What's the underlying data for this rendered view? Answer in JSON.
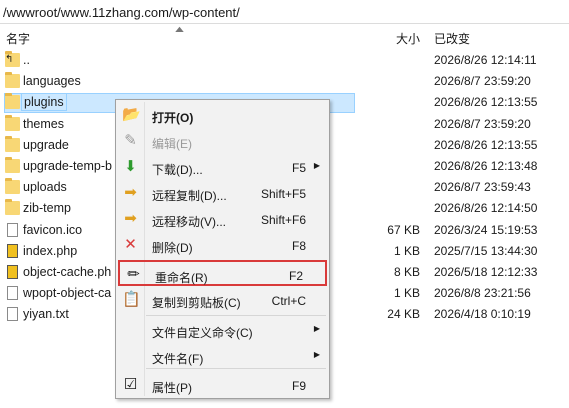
{
  "path": "/wwwroot/www.11zhang.com/wp-content/",
  "columns": {
    "name": "名字",
    "size": "大小",
    "modified": "已改变"
  },
  "files": [
    {
      "name": "..",
      "size": "",
      "modified": "2026/8/26 12:14:11",
      "type": "up-folder"
    },
    {
      "name": "languages",
      "size": "",
      "modified": "2026/8/7 23:59:20",
      "type": "folder"
    },
    {
      "name": "plugins",
      "size": "",
      "modified": "2026/8/26 12:13:55",
      "type": "folder"
    },
    {
      "name": "themes",
      "size": "",
      "modified": "2026/8/7 23:59:20",
      "type": "folder"
    },
    {
      "name": "upgrade",
      "size": "",
      "modified": "2026/8/26 12:13:55",
      "type": "folder"
    },
    {
      "name": "upgrade-temp-b",
      "size": "",
      "modified": "2026/8/26 12:13:48",
      "type": "folder"
    },
    {
      "name": "uploads",
      "size": "",
      "modified": "2026/8/7 23:59:43",
      "type": "folder"
    },
    {
      "name": "zib-temp",
      "size": "",
      "modified": "2026/8/26 12:14:50",
      "type": "folder"
    },
    {
      "name": "favicon.ico",
      "size": "67 KB",
      "modified": "2026/3/24 15:19:53",
      "type": "file"
    },
    {
      "name": "index.php",
      "size": "1 KB",
      "modified": "2025/7/15 13:44:30",
      "type": "php"
    },
    {
      "name": "object-cache.ph",
      "size": "8 KB",
      "modified": "2026/5/18 12:12:33",
      "type": "php"
    },
    {
      "name": "wpopt-object-ca",
      "size": "1 KB",
      "modified": "2026/8/8 23:21:56",
      "type": "file"
    },
    {
      "name": "yiyan.txt",
      "size": "24 KB",
      "modified": "2026/4/18 0:10:19",
      "type": "txt"
    }
  ],
  "menu": [
    {
      "label": "打开(O)",
      "shortcut": "",
      "icon": "folder-open-icon",
      "glyph": "📂",
      "bold": true
    },
    {
      "label": "编辑(E)",
      "shortcut": "",
      "icon": "edit-icon",
      "glyph": "✎",
      "disabled": true
    },
    {
      "label": "下载(D)...",
      "shortcut": "F5",
      "icon": "download-icon",
      "glyph": "⬇",
      "submenu": true
    },
    {
      "label": "远程复制(D)...",
      "shortcut": "Shift+F5",
      "icon": "remote-copy-icon",
      "glyph": "➡"
    },
    {
      "label": "远程移动(V)...",
      "shortcut": "Shift+F6",
      "icon": "remote-move-icon",
      "glyph": "➡"
    },
    {
      "label": "删除(D)",
      "shortcut": "F8",
      "icon": "delete-icon",
      "glyph": "✕"
    },
    {
      "label": "重命名(R)",
      "shortcut": "F2",
      "icon": "rename-icon",
      "glyph": "✏",
      "highlight": true
    },
    {
      "label": "复制到剪贴板(C)",
      "shortcut": "Ctrl+C",
      "icon": "clipboard-icon",
      "glyph": "📋"
    },
    {
      "label": "文件自定义命令(C)",
      "shortcut": "",
      "icon": "",
      "glyph": "",
      "submenu": true
    },
    {
      "label": "文件名(F)",
      "shortcut": "",
      "icon": "",
      "glyph": "",
      "submenu": true
    },
    {
      "label": "属性(P)",
      "shortcut": "F9",
      "icon": "properties-icon",
      "glyph": "☑"
    }
  ],
  "colors": {
    "selection": "#cce8ff",
    "highlight_border": "#d93a3a",
    "folder": "#f8d775"
  }
}
